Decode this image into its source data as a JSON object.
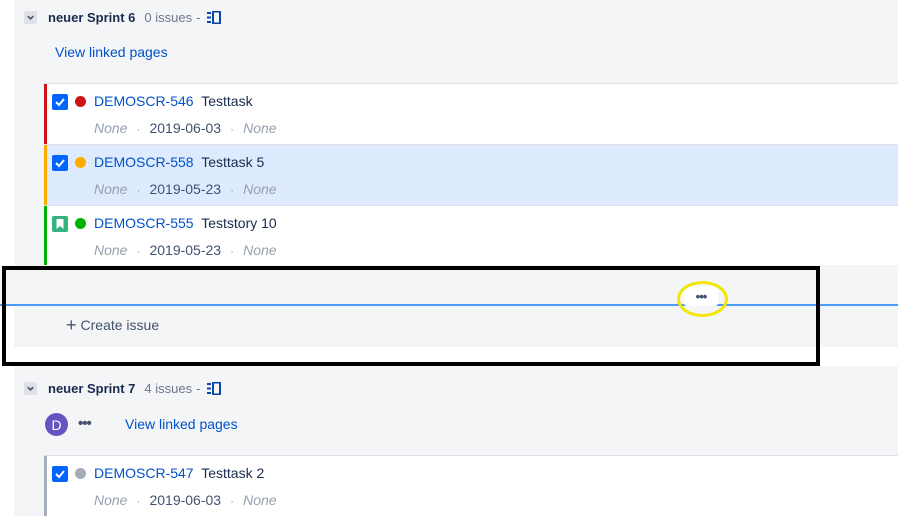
{
  "sprints": [
    {
      "name": "neuer Sprint 6",
      "count": "0 issues",
      "separator": "-",
      "view_linked_pages": "View linked pages",
      "issues": [
        {
          "key": "DEMOSCR-546",
          "summary": "Testtask",
          "type": "task",
          "priority": "highest",
          "priority_color": "#cd1317",
          "bar_color": "#cd1317",
          "field1": "None",
          "date": "2019-06-03",
          "field3": "None",
          "selected": false
        },
        {
          "key": "DEMOSCR-558",
          "summary": "Testtask 5",
          "type": "task",
          "priority": "medium",
          "priority_color": "#ffab00",
          "bar_color": "#ffab00",
          "field1": "None",
          "date": "2019-05-23",
          "field3": "None",
          "selected": true
        },
        {
          "key": "DEMOSCR-555",
          "summary": "Teststory 10",
          "type": "story",
          "priority": "low",
          "priority_color": "#00b300",
          "bar_color": "#00b300",
          "field1": "None",
          "date": "2019-05-23",
          "field3": "None",
          "selected": false
        }
      ],
      "more_label": "•••",
      "create_issue": "Create issue"
    },
    {
      "name": "neuer Sprint 7",
      "count": "4 issues",
      "separator": "-",
      "avatar_initial": "D",
      "more_label": "•••",
      "view_linked_pages": "View linked pages",
      "issues": [
        {
          "key": "DEMOSCR-547",
          "summary": "Testtask 2",
          "type": "task",
          "priority": "none",
          "priority_color": "#a5adba",
          "bar_color": "#a5adba",
          "field1": "None",
          "date": "2019-06-03",
          "field3": "None",
          "selected": false
        }
      ]
    }
  ],
  "colors": {
    "link": "#0052cc",
    "panel_bg": "#f4f5f7",
    "selected_bg": "#deebff",
    "drop_line": "#4c9aff",
    "annotation_rect": "#000000",
    "annotation_ellipse": "#f3e600"
  }
}
